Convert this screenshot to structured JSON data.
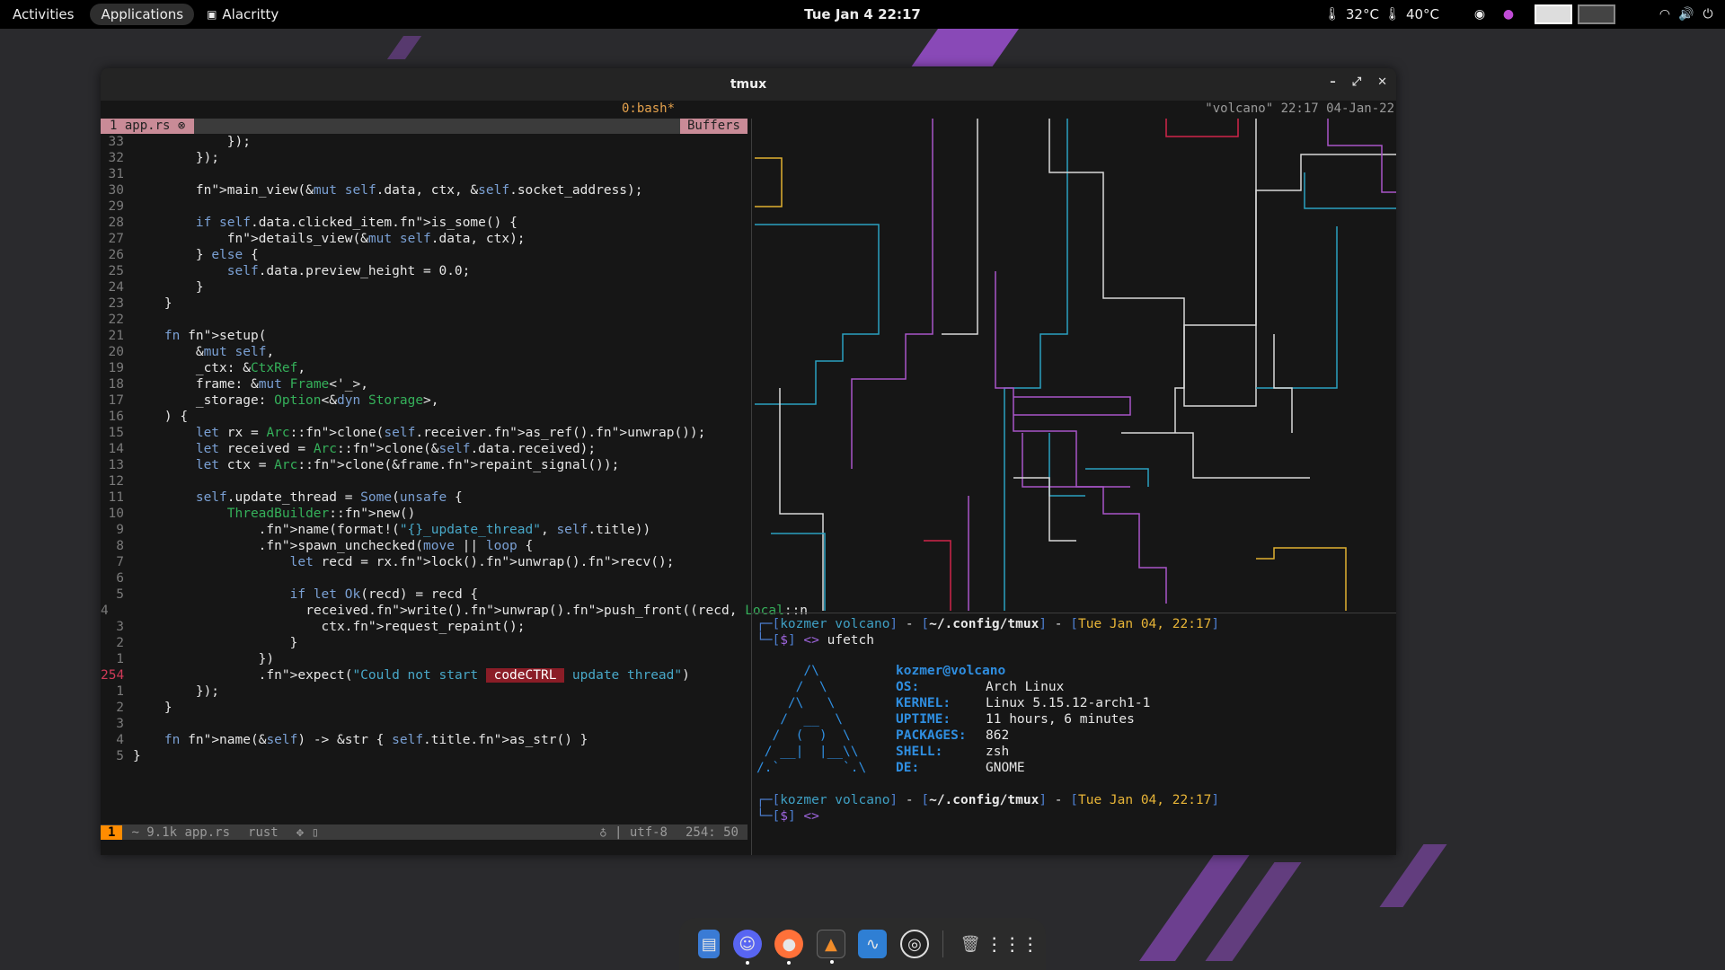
{
  "topbar": {
    "activities": "Activities",
    "applications": "Applications",
    "app_name": "Alacritty",
    "clock": "Tue Jan 4  22:17",
    "temp1": "32°C",
    "temp2": "40°C"
  },
  "window": {
    "title": "tmux",
    "minimize": "–",
    "maximize": "⤢",
    "close": "✕"
  },
  "tmux": {
    "window_label": "0:bash*",
    "right_status": "\"volcano\" 22:17 04-Jan-22"
  },
  "editor": {
    "tab": "1 app.rs ⊗",
    "buffers": "Buffers",
    "status": {
      "mode": "1",
      "file": "~ 9.1k app.rs",
      "filetype": "rust",
      "git": "✥ ▯",
      "encoding": "♁ | utf-8",
      "position": "254: 50"
    },
    "lines": [
      {
        "n": "33",
        "t": "            });"
      },
      {
        "n": "32",
        "t": "        });"
      },
      {
        "n": "31",
        "t": ""
      },
      {
        "n": "30",
        "t": "        main_view(&mut self.data, ctx, &self.socket_address);"
      },
      {
        "n": "29",
        "t": ""
      },
      {
        "n": "28",
        "t": "        if self.data.clicked_item.is_some() {"
      },
      {
        "n": "27",
        "t": "            details_view(&mut self.data, ctx);"
      },
      {
        "n": "26",
        "t": "        } else {"
      },
      {
        "n": "25",
        "t": "            self.data.preview_height = 0.0;"
      },
      {
        "n": "24",
        "t": "        }"
      },
      {
        "n": "23",
        "t": "    }"
      },
      {
        "n": "22",
        "t": ""
      },
      {
        "n": "21",
        "t": "    fn setup("
      },
      {
        "n": "20",
        "t": "        &mut self,"
      },
      {
        "n": "19",
        "t": "        _ctx: &CtxRef,"
      },
      {
        "n": "18",
        "t": "        frame: &mut Frame<'_>,"
      },
      {
        "n": "17",
        "t": "        _storage: Option<&dyn Storage>,"
      },
      {
        "n": "16",
        "t": "    ) {"
      },
      {
        "n": "15",
        "t": "        let rx = Arc::clone(self.receiver.as_ref().unwrap());"
      },
      {
        "n": "14",
        "t": "        let received = Arc::clone(&self.data.received);"
      },
      {
        "n": "13",
        "t": "        let ctx = Arc::clone(&frame.repaint_signal());"
      },
      {
        "n": "12",
        "t": ""
      },
      {
        "n": "11",
        "t": "        self.update_thread = Some(unsafe {"
      },
      {
        "n": "10",
        "t": "            ThreadBuilder::new()"
      },
      {
        "n": "9",
        "t": "                .name(format!(\"{}_update_thread\", self.title))"
      },
      {
        "n": "8",
        "t": "                .spawn_unchecked(move || loop {"
      },
      {
        "n": "7",
        "t": "                    let recd = rx.lock().unwrap().recv();"
      },
      {
        "n": "6",
        "t": ""
      },
      {
        "n": "5",
        "t": "                    if let Ok(recd) = recd {"
      },
      {
        "n": "4",
        "t": "                        received.write().unwrap().push_front((recd, Local::n"
      },
      {
        "n": "3",
        "t": "                        ctx.request_repaint();"
      },
      {
        "n": "2",
        "t": "                    }"
      },
      {
        "n": "1",
        "t": "                })"
      },
      {
        "n": "254",
        "t": "                .expect(\"Could not start  codeCTRL  update thread\")",
        "current": true
      },
      {
        "n": "1",
        "t": "        });"
      },
      {
        "n": "2",
        "t": "    }"
      },
      {
        "n": "3",
        "t": ""
      },
      {
        "n": "4",
        "t": "    fn name(&self) -> &str { self.title.as_str() }"
      },
      {
        "n": "5",
        "t": "}"
      }
    ]
  },
  "shell": {
    "prompt1": {
      "user": "kozmer volcano",
      "path": "~/.config/tmux",
      "date": "Tue Jan 04, 22:17",
      "cmd": "ufetch"
    },
    "ufetch": {
      "ascii": [
        "      /\\",
        "     /  \\",
        "    /\\   \\",
        "   /  __  \\",
        "  /  (  )  \\",
        " / __|  |__\\\\",
        "/.`        `.\\"
      ],
      "user_host": "kozmer@volcano",
      "rows": [
        {
          "k": "OS:",
          "v": "Arch Linux"
        },
        {
          "k": "KERNEL:",
          "v": "Linux 5.15.12-arch1-1"
        },
        {
          "k": "UPTIME:",
          "v": "11 hours, 6 minutes"
        },
        {
          "k": "PACKAGES:",
          "v": "862"
        },
        {
          "k": "SHELL:",
          "v": "zsh"
        },
        {
          "k": "DE:",
          "v": "GNOME"
        }
      ]
    },
    "prompt2": {
      "user": "kozmer volcano",
      "path": "~/.config/tmux",
      "date": "Tue Jan 04, 22:17"
    }
  },
  "dock": {
    "icons": [
      "files-icon",
      "discord-icon",
      "firefox-icon",
      "alacritty-icon",
      "system-monitor-icon",
      "obs-icon",
      "trash-icon",
      "app-grid-icon"
    ]
  }
}
